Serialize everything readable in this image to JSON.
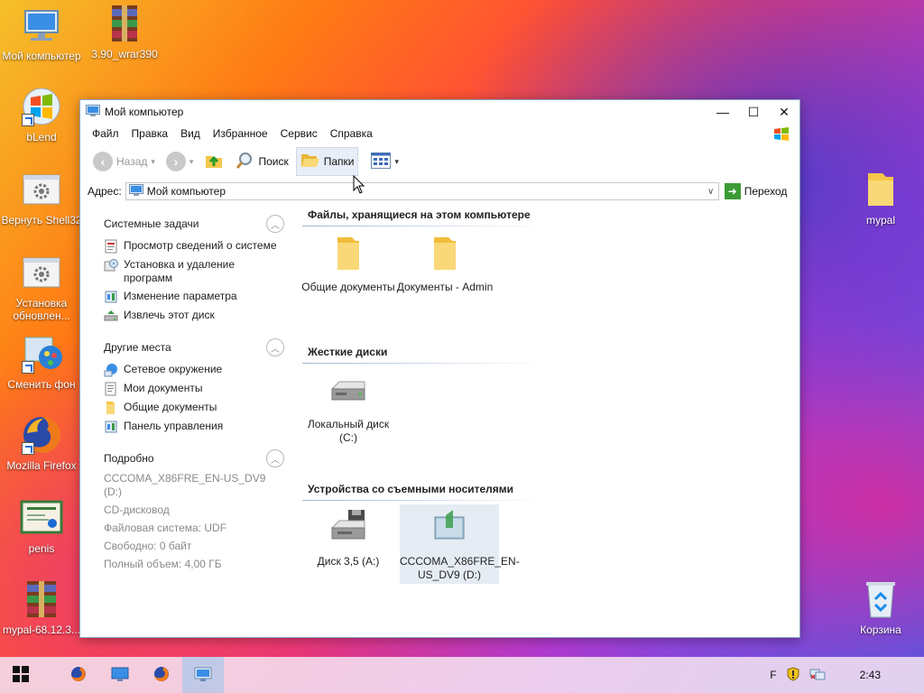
{
  "desktop": {
    "icons": [
      {
        "label": "Мой компьютер",
        "icon": "monitor-icon"
      },
      {
        "label": "3.90_wrar390",
        "icon": "winrar-icon"
      },
      {
        "label": "bLend",
        "icon": "windows-logo-icon"
      },
      {
        "label": "Вернуть Shell32",
        "icon": "settings-doc-icon"
      },
      {
        "label": "Установка обновлен...",
        "icon": "settings-doc-icon"
      },
      {
        "label": "Сменить фон",
        "icon": "palette-icon"
      },
      {
        "label": "Mozilla Firefox",
        "icon": "firefox-icon"
      },
      {
        "label": "penis",
        "icon": "certificate-icon"
      },
      {
        "label": "mypal-68.12.3...",
        "icon": "winrar-icon"
      },
      {
        "label": "mypal",
        "icon": "folder-icon"
      },
      {
        "label": "Корзина",
        "icon": "recycle-bin-icon"
      }
    ]
  },
  "window": {
    "title": "Мой компьютер",
    "controls": {
      "minimize": "—",
      "maximize": "☐",
      "close": "✕"
    },
    "menu": [
      "Файл",
      "Правка",
      "Вид",
      "Избранное",
      "Сервис",
      "Справка"
    ],
    "toolbar": {
      "back": "Назад",
      "search": "Поиск",
      "folders": "Папки"
    },
    "address": {
      "label": "Адрес:",
      "value": "Мой компьютер",
      "go": "Переход"
    },
    "left_pane": {
      "system_tasks": {
        "title": "Системные задачи",
        "items": [
          "Просмотр сведений о системе",
          "Установка и удаление программ",
          "Изменение параметра",
          "Извлечь этот диск"
        ]
      },
      "other_places": {
        "title": "Другие места",
        "items": [
          "Сетевое окружение",
          "Мои документы",
          "Общие документы",
          "Панель управления"
        ]
      },
      "details": {
        "title": "Подробно",
        "lines": [
          "CCCOMA_X86FRE_EN-US_DV9 (D:)",
          "CD-дисковод",
          "Файловая система: UDF",
          "Свободно: 0 байт",
          "Полный объем: 4,00 ГБ"
        ]
      }
    },
    "groups": [
      {
        "title": "Файлы, хранящиеся на этом компьютере",
        "items": [
          {
            "label": "Общие документы",
            "icon": "folder-icon"
          },
          {
            "label": "Документы - Admin",
            "icon": "folder-icon"
          }
        ]
      },
      {
        "title": "Жесткие диски",
        "items": [
          {
            "label": "Локальный диск (C:)",
            "icon": "hard-drive-icon"
          }
        ]
      },
      {
        "title": "Устройства со съемными носителями",
        "items": [
          {
            "label": "Диск 3,5 (A:)",
            "icon": "floppy-drive-icon"
          },
          {
            "label": "CCCOMA_X86FRE_EN-US_DV9 (D:)",
            "icon": "dvd-drive-icon"
          }
        ]
      }
    ]
  },
  "taskbar": {
    "tray_lang": "F",
    "clock": "2:43"
  }
}
